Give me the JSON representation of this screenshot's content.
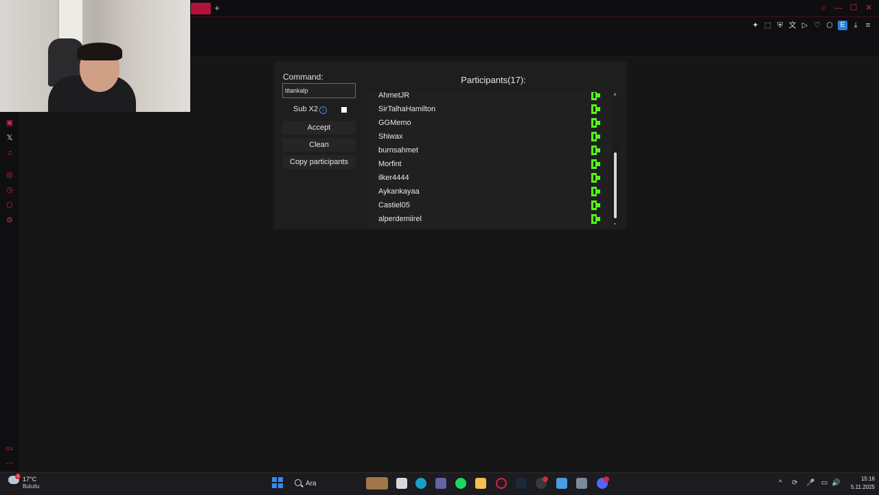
{
  "browser": {
    "new_tab_symbol": "+",
    "window_controls": [
      "⌕",
      "—",
      "☐",
      "✕"
    ],
    "toolbar_icons": [
      "pin-icon",
      "screenshot-icon",
      "shield-icon",
      "translate-icon",
      "play-icon",
      "heart-icon",
      "extensions-icon",
      "extension-e-icon",
      "download-icon",
      "menu-icon"
    ],
    "extension_letter": "E"
  },
  "sidebar": {
    "items": [
      "twitch-icon",
      "x-icon",
      "music-icon",
      "player-icon",
      "history-icon",
      "extensions-icon",
      "settings-icon"
    ],
    "x_symbol": "𝕏",
    "bottom_label": "GX",
    "more_symbol": "⋯"
  },
  "app": {
    "command_label": "Command:",
    "command_value": "titankalp",
    "sub_label": "Sub X2",
    "info_symbol": "i",
    "buttons": {
      "accept": "Accept",
      "clean": "Clean",
      "copy": "Copy participants"
    },
    "participants_title": "Participants(17):",
    "participants": [
      "AhmetJR",
      "SirTalhaHamilton",
      "GGMemo",
      "Shiwax",
      "burnsahmet",
      "Morfint",
      "ilker4444",
      "Aykankayaa",
      "Castiel05",
      "alperdemiirel"
    ],
    "scroll_up_symbol": "▲",
    "scroll_down_symbol": "⌄",
    "kick_color": "#53fc18"
  },
  "taskbar": {
    "weather_temp": "17°C",
    "weather_desc": "Bulutlu",
    "weather_badge": "1",
    "search_placeholder": "Ara",
    "apps": [
      "file-explorer-icon",
      "edge-icon",
      "teams-icon",
      "spotify-icon",
      "folder-icon",
      "opera-gx-icon",
      "steam-icon",
      "obs-icon",
      "notepad-icon",
      "settings-icon",
      "discord-icon"
    ],
    "tray": [
      "chevron-up-icon",
      "sync-icon",
      "mic-icon",
      "display-icon",
      "volume-icon"
    ],
    "tray_symbols": [
      "^",
      "⟳",
      "🎤",
      "▭",
      "🔊"
    ],
    "clock_time": "15:16",
    "clock_date": "5.11.2025"
  }
}
